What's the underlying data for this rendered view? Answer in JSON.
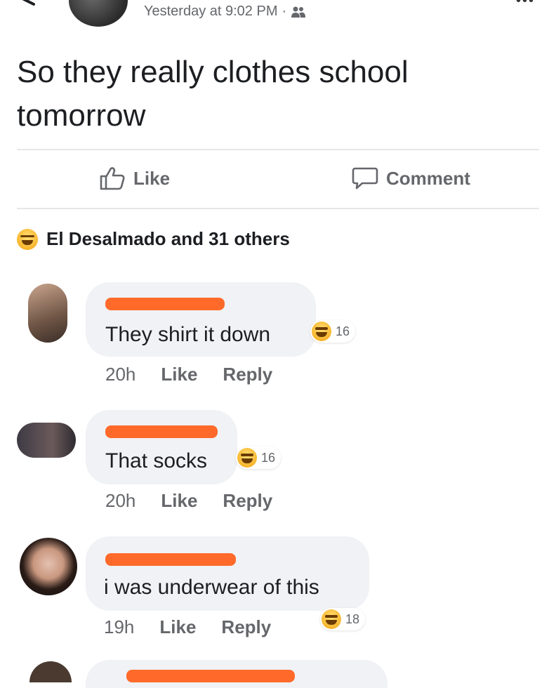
{
  "post": {
    "timestamp": "Yesterday at 9:02 PM",
    "separator": "·",
    "audience_icon": "friends-icon",
    "text": "So they really clothes school tomorrow"
  },
  "actions": {
    "like_label": "Like",
    "comment_label": "Comment"
  },
  "reactions": {
    "icon": "haha-emoji",
    "summary": "El Desalmado and 31 others"
  },
  "comments": [
    {
      "author": "redacted",
      "text": "They shirt it down",
      "time": "20h",
      "like": "Like",
      "reply": "Reply",
      "reaction_count": "16"
    },
    {
      "author": "redacted",
      "text": "That socks",
      "time": "20h",
      "like": "Like",
      "reply": "Reply",
      "reaction_count": "16"
    },
    {
      "author": "redacted",
      "text": "i was underwear of this",
      "time": "19h",
      "like": "Like",
      "reply": "Reply",
      "reaction_count": "18"
    }
  ],
  "colors": {
    "secondary_text": "#65676b",
    "bubble": "#f0f2f5",
    "redaction": "#ff6a2a",
    "haha": "#f7b125"
  }
}
